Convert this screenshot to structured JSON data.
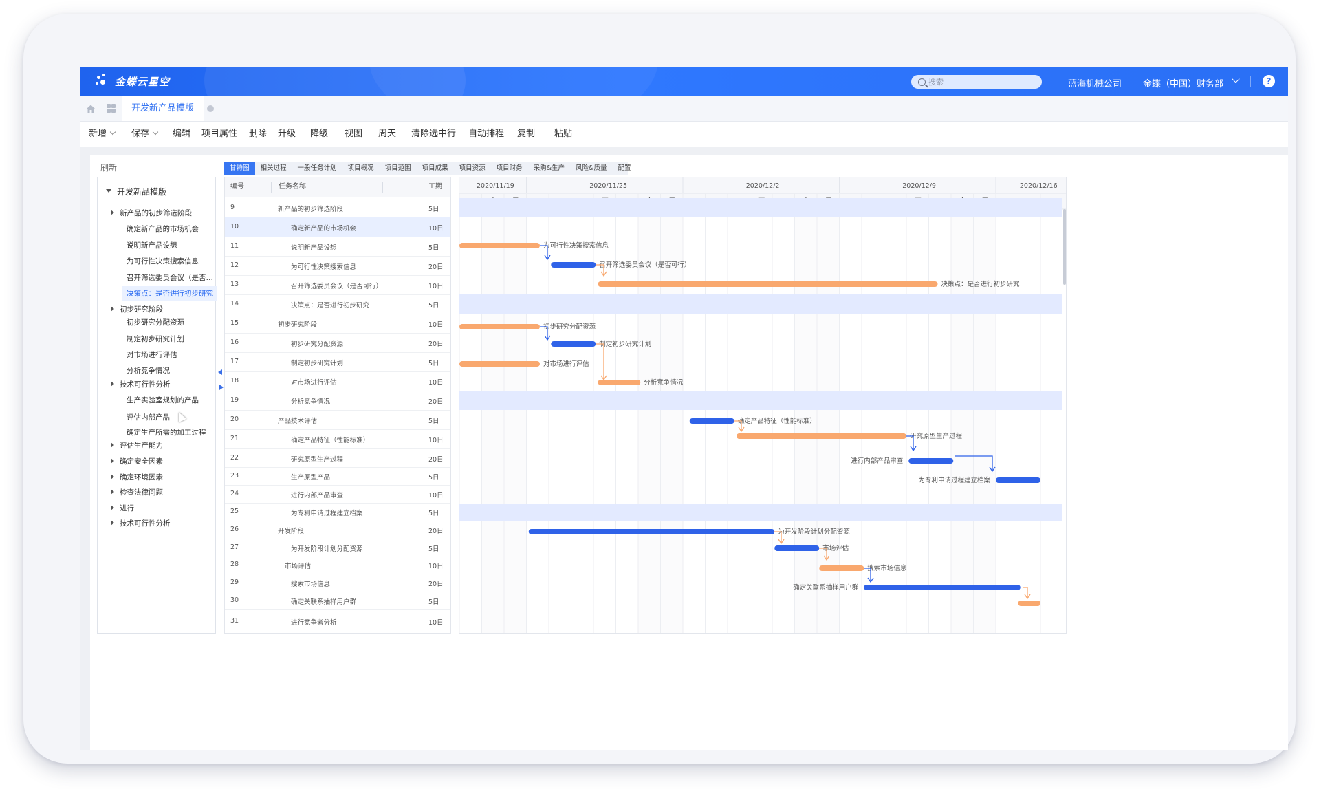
{
  "app": {
    "logo_text": "金蝶云星空",
    "search_placeholder": "搜索",
    "company": "蓝海机械公司",
    "org": "金蝶（中国）财务部",
    "help": "?"
  },
  "tabs": {
    "active": "开发新产品模版"
  },
  "toolbar": {
    "new": "新增",
    "save": "保存",
    "edit": "编辑",
    "project_props": "项目属性",
    "delete": "删除",
    "upgrade": "升级",
    "downgrade": "降级",
    "view": "视图",
    "weekday": "周天",
    "clear_selected": "清除选中行",
    "auto_schedule": "自动排程",
    "copy": "复制",
    "paste": "粘贴"
  },
  "sidebar": {
    "refresh": "刷新",
    "root": "开发新品模版",
    "items": [
      {
        "label": "新产品的初步筛选阶段",
        "level": 1,
        "caret": true
      },
      {
        "label": "确定新产品的市场机会",
        "level": 2
      },
      {
        "label": "说明新产品设想",
        "level": 2
      },
      {
        "label": "为可行性决策搜索信息",
        "level": 2
      },
      {
        "label": "召开筛选委员会议（是否…",
        "level": 2
      },
      {
        "label": "决策点：是否进行初步研究",
        "level": 2,
        "selected": true
      },
      {
        "label": "初步研究阶段",
        "level": 1,
        "caret": true
      },
      {
        "label": "初步研究分配资源",
        "level": 2
      },
      {
        "label": "制定初步研究计划",
        "level": 2
      },
      {
        "label": "对市场进行评估",
        "level": 2
      },
      {
        "label": "分析竞争情况",
        "level": 2
      },
      {
        "label": "技术可行性分析",
        "level": 1,
        "caret": true
      },
      {
        "label": "生产实验室规划的产品",
        "level": 2
      },
      {
        "label": "评估内部产品",
        "level": 2
      },
      {
        "label": "确定生产所需的加工过程",
        "level": 2
      },
      {
        "label": "评估生产能力",
        "level": 1,
        "caret": true
      },
      {
        "label": "确定安全因素",
        "level": 1,
        "caret": true
      },
      {
        "label": "确定环境因素",
        "level": 1,
        "caret": true
      },
      {
        "label": "检查法律问题",
        "level": 1,
        "caret": true
      },
      {
        "label": "进行",
        "level": 1,
        "caret": true
      },
      {
        "label": "技术可行性分析",
        "level": 1,
        "caret": true
      }
    ]
  },
  "subtabs": [
    "甘特图",
    "相关过程",
    "一般任务计划",
    "项目概况",
    "项目范围",
    "项目成果",
    "项目资源",
    "项目财务",
    "采购&生产",
    "风险&质量",
    "配置"
  ],
  "table": {
    "headers": {
      "id": "编号",
      "name": "任务名称",
      "duration": "工期"
    },
    "rows": [
      {
        "id": "9",
        "name": "新产品的初步筛选阶段",
        "dur": "5日",
        "level": 1
      },
      {
        "id": "10",
        "name": "确定新产品的市场机会",
        "dur": "10日",
        "level": 2
      },
      {
        "id": "11",
        "name": "说明新产品设想",
        "dur": "5日",
        "level": 2
      },
      {
        "id": "12",
        "name": "为可行性决策搜索信息",
        "dur": "20日",
        "level": 2
      },
      {
        "id": "13",
        "name": "召开筛选委员会议（是否可行）",
        "dur": "10日",
        "level": 2
      },
      {
        "id": "14",
        "name": "决策点：是否进行初步研究",
        "dur": "5日",
        "level": 2
      },
      {
        "id": "15",
        "name": "初步研究阶段",
        "dur": "10日",
        "level": 1
      },
      {
        "id": "16",
        "name": "初步研究分配资源",
        "dur": "20日",
        "level": 2
      },
      {
        "id": "17",
        "name": "制定初步研究计划",
        "dur": "5日",
        "level": 2
      },
      {
        "id": "18",
        "name": "对市场进行评估",
        "dur": "10日",
        "level": 2
      },
      {
        "id": "19",
        "name": "分析竞争情况",
        "dur": "20日",
        "level": 2
      },
      {
        "id": "20",
        "name": "产品技术评估",
        "dur": "5日",
        "level": 1
      },
      {
        "id": "21",
        "name": "确定产品特征（性能标准）",
        "dur": "10日",
        "level": 2
      },
      {
        "id": "22",
        "name": "研究原型生产过程",
        "dur": "20日",
        "level": 2
      },
      {
        "id": "23",
        "name": "生产原型产品",
        "dur": "5日",
        "level": 2
      },
      {
        "id": "24",
        "name": "进行内部产品审查",
        "dur": "10日",
        "level": 2
      },
      {
        "id": "25",
        "name": "为专利申请过程建立档案",
        "dur": "5日",
        "level": 2
      },
      {
        "id": "26",
        "name": "开发阶段",
        "dur": "20日",
        "level": 1
      },
      {
        "id": "27",
        "name": "为开发阶段计划分配资源",
        "dur": "5日",
        "level": 2
      },
      {
        "id": "28",
        "name": "市场评估",
        "dur": "10日",
        "level": 1.5
      },
      {
        "id": "29",
        "name": "搜索市场信息",
        "dur": "20日",
        "level": 2
      },
      {
        "id": "30",
        "name": "确定关联系抽样用户群",
        "dur": "5日",
        "level": 2
      },
      {
        "id": "31",
        "name": "进行竞争者分析",
        "dur": "10日",
        "level": 2
      }
    ]
  },
  "gantt": {
    "week_labels": [
      "2020/11/19",
      "2020/11/25",
      "2020/12/2",
      "2020/12/9",
      "2020/12/16"
    ],
    "day_labels": [
      "五",
      "六",
      "日",
      "一",
      "二",
      "三",
      "四",
      "五",
      "六",
      "日",
      "一",
      "二",
      "三",
      "四",
      "五",
      "六",
      "日",
      "一",
      "二",
      "三",
      "四",
      "五",
      "六",
      "日",
      "一",
      "二",
      "三"
    ],
    "bars": [
      {
        "label": "为可行性决策搜索信息",
        "color": "orange",
        "start": 0,
        "len": 3.6
      },
      {
        "label": "召开筛选委员会议（是否可行）",
        "color": "blue",
        "start": 4.1,
        "len": 2.0
      },
      {
        "label": "决策点：是否进行初步研究",
        "color": "orange",
        "start": 6.2,
        "len": 15.2
      },
      {
        "label": "初步研究分配资源",
        "color": "orange",
        "start": 0,
        "len": 3.6
      },
      {
        "label": "制定初步研究计划",
        "color": "blue",
        "start": 4.1,
        "len": 2.0
      },
      {
        "label": "对市场进行评估",
        "color": "orange",
        "start": 0,
        "len": 3.6
      },
      {
        "label": "分析竞争情况",
        "color": "orange",
        "start": 6.2,
        "len": 1.9
      },
      {
        "label": "确定产品特征（性能标准）",
        "color": "blue",
        "start": 10.3,
        "len": 2.0
      },
      {
        "label": "研究原型生产过程",
        "color": "orange",
        "start": 12.4,
        "len": 7.6
      },
      {
        "label": "进行内部产品审查",
        "color": "blue",
        "start": 20.1,
        "len": 2.0
      },
      {
        "label": "为专利申请过程建立档案",
        "color": "blue",
        "start": 24.0,
        "len": 2.0
      },
      {
        "label": "为开发阶段计划分配资源",
        "color": "blue",
        "start": 3.1,
        "len": 11.0
      },
      {
        "label": "市场评估",
        "color": "blue",
        "start": 14.1,
        "len": 2.0
      },
      {
        "label": "搜索市场信息",
        "color": "orange",
        "start": 16.1,
        "len": 2.0
      },
      {
        "label": "确定关联系抽样用户群",
        "color": "blue",
        "start": 18.1,
        "len": 7.0
      },
      {
        "label": "",
        "color": "orange",
        "start": 25.0,
        "len": 1.0
      }
    ]
  },
  "colors": {
    "blue": "#2f62e8",
    "orange": "#f9a86e",
    "accent": "#3776f2",
    "phase_band": "#e3eaff"
  }
}
